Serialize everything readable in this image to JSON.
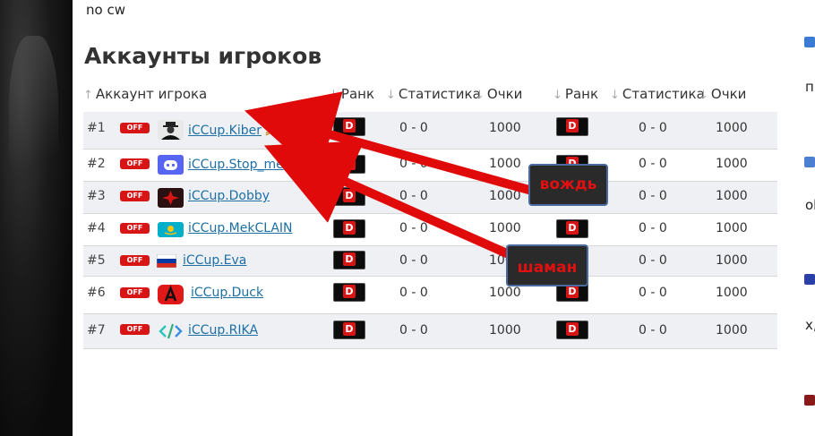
{
  "header_text": "no cw",
  "section_title": "Аккаунты игроков",
  "columns": {
    "account": "Аккаунт игрока",
    "rank1": "Ранк",
    "stats1": "Статистика",
    "score1": "Очки",
    "rank2": "Ранк",
    "stats2": "Статистика",
    "score2": "Очки"
  },
  "status_label": "OFF",
  "rank_letter": "D",
  "players": [
    {
      "num": "#1",
      "name": "iCCup.Kiber",
      "stats1": "0 - 0",
      "score1": "1000",
      "stats2": "0 - 0",
      "score2": "1000",
      "chevron": "chevron-double-up-icon"
    },
    {
      "num": "#2",
      "name": "iCCup.Stop_me",
      "stats1": "0 - 0",
      "score1": "1000",
      "stats2": "0 - 0",
      "score2": "1000",
      "chevron": "chevron-up-icon"
    },
    {
      "num": "#3",
      "name": "iCCup.Dobby",
      "stats1": "0 - 0",
      "score1": "1000",
      "stats2": "0 - 0",
      "score2": "1000"
    },
    {
      "num": "#4",
      "name": "iCCup.MekCLAIN",
      "stats1": "0 - 0",
      "score1": "1000",
      "stats2": "0 - 0",
      "score2": "1000"
    },
    {
      "num": "#5",
      "name": "iCCup.Eva",
      "stats1": "0 - 0",
      "score1": "1000",
      "stats2": "0 - 0",
      "score2": "1000"
    },
    {
      "num": "#6",
      "name": "iCCup.Duck",
      "stats1": "0 - 0",
      "score1": "1000",
      "stats2": "0 - 0",
      "score2": "1000"
    },
    {
      "num": "#7",
      "name": "iCCup.RIKA",
      "stats1": "0 - 0",
      "score1": "1000",
      "stats2": "0 - 0",
      "score2": "1000"
    }
  ],
  "annotations": {
    "chief": "вождь",
    "shaman": "шаман"
  },
  "right_strip": {
    "t1": "п",
    "t2": "ol",
    "t3": "х,"
  },
  "colors": {
    "off_badge": "#d81515",
    "link": "#1d6fa5",
    "arrow": "#e00a0a",
    "callout_border": "#4a6aa0"
  }
}
